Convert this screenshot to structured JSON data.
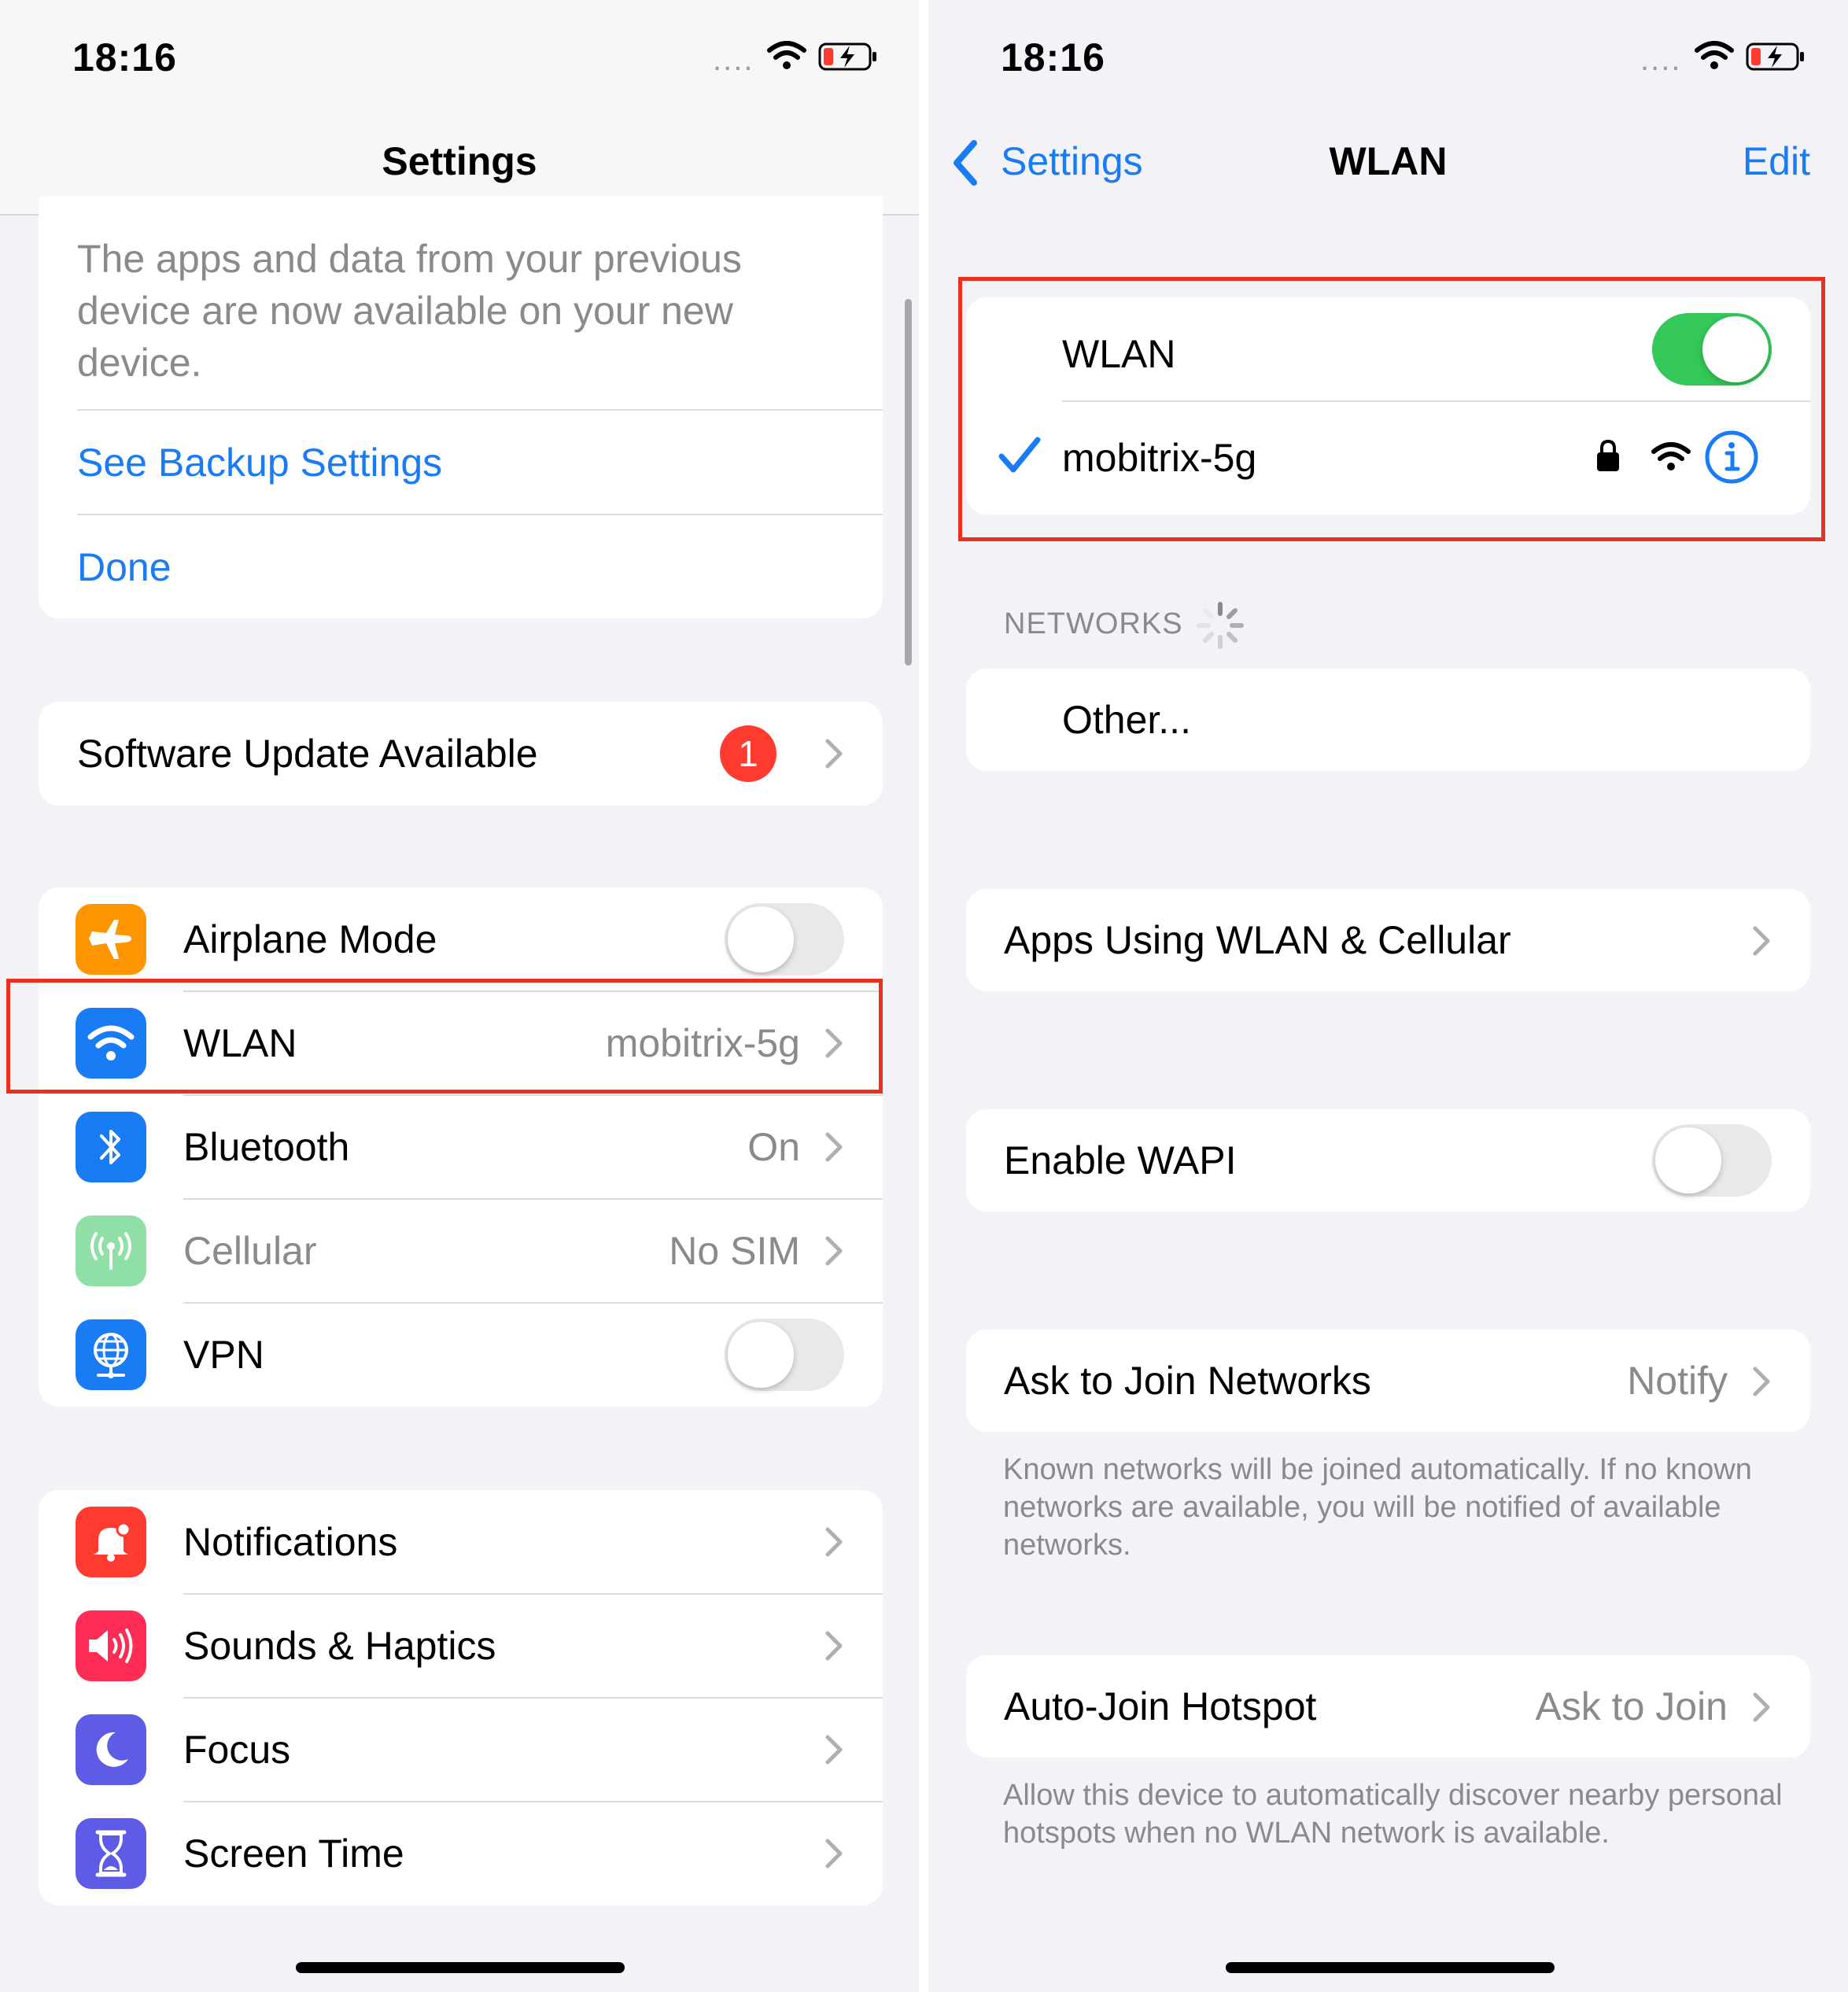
{
  "left": {
    "status": {
      "time": "18:16"
    },
    "nav": {
      "title": "Settings"
    },
    "backup": {
      "message": "The apps and data from your previous device are now available on your new device.",
      "see_backup": "See Backup Settings",
      "done": "Done"
    },
    "software_update": {
      "label": "Software Update Available",
      "badge": "1"
    },
    "connectivity": [
      {
        "label": "Airplane Mode",
        "icon": "airplane-icon",
        "color": "#ff9500",
        "toggle": false
      },
      {
        "label": "WLAN",
        "value": "mobitrix-5g",
        "icon": "wifi-icon",
        "color": "#1a7cf5"
      },
      {
        "label": "Bluetooth",
        "value": "On",
        "icon": "bluetooth-icon",
        "color": "#1a7cf5"
      },
      {
        "label": "Cellular",
        "value": "No SIM",
        "icon": "cellular-antenna-icon",
        "color": "#8fdfa6",
        "disabled": true
      },
      {
        "label": "VPN",
        "icon": "globe-network-icon",
        "color": "#1a7cf5",
        "toggle": false
      }
    ],
    "general": [
      {
        "label": "Notifications",
        "icon": "bell-icon",
        "color": "#ff3b30"
      },
      {
        "label": "Sounds & Haptics",
        "icon": "speaker-icon",
        "color": "#ff2d55"
      },
      {
        "label": "Focus",
        "icon": "moon-icon",
        "color": "#5e5ce6"
      },
      {
        "label": "Screen Time",
        "icon": "hourglass-icon",
        "color": "#5e5ce6"
      }
    ]
  },
  "right": {
    "status": {
      "time": "18:16"
    },
    "nav": {
      "back": "Settings",
      "title": "WLAN",
      "edit": "Edit"
    },
    "wlan": {
      "label": "WLAN",
      "toggle": true,
      "network": "mobitrix-5g"
    },
    "networks_header": "NETWORKS",
    "other": "Other...",
    "apps_using": "Apps Using WLAN & Cellular",
    "enable_wapi": {
      "label": "Enable WAPI",
      "toggle": false
    },
    "ask_to_join": {
      "label": "Ask to Join Networks",
      "value": "Notify",
      "footer": "Known networks will be joined automatically. If no known networks are available, you will be notified of available networks."
    },
    "auto_join": {
      "label": "Auto-Join Hotspot",
      "value": "Ask to Join",
      "footer": "Allow this device to automatically discover nearby personal hotspots when no WLAN network is available."
    }
  },
  "colors": {
    "accent_blue": "#1a7cf5",
    "toggle_green": "#34c759",
    "highlight_red": "#e8321f",
    "badge_red": "#ff3b30",
    "background": "#f2f2f7"
  }
}
